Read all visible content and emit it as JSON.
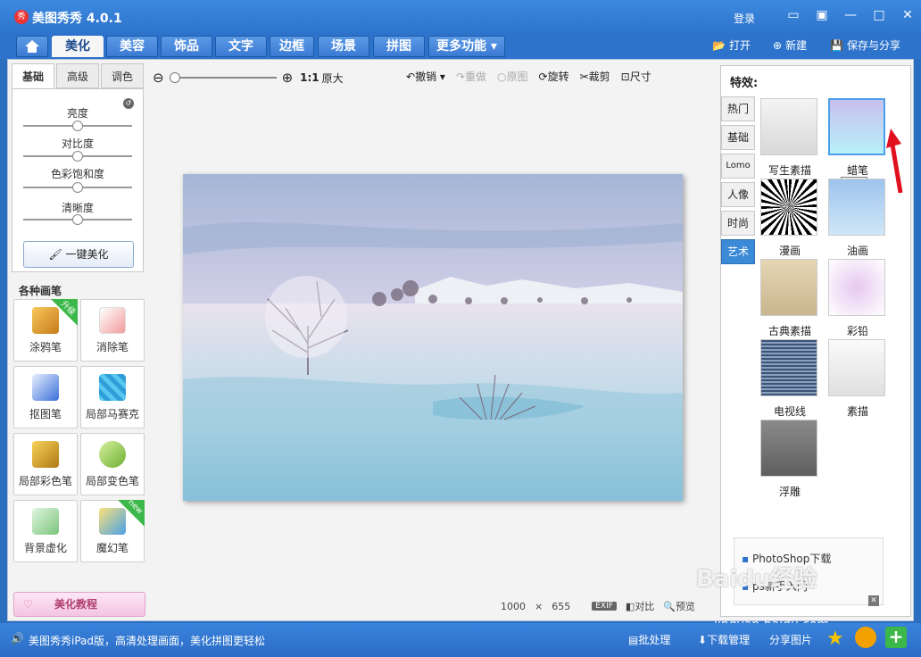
{
  "title": {
    "app_name": "美图秀秀 4.0.1",
    "login": "登录"
  },
  "tabs": [
    {
      "label": "美化"
    },
    {
      "label": "美容"
    },
    {
      "label": "饰品"
    },
    {
      "label": "文字"
    },
    {
      "label": "边框"
    },
    {
      "label": "场景"
    },
    {
      "label": "拼图"
    },
    {
      "label": "更多功能"
    }
  ],
  "file_actions": {
    "open": "打开",
    "new": "新建",
    "save_share": "保存与分享"
  },
  "left_panel": {
    "subtabs": [
      "基础",
      "高级",
      "调色"
    ],
    "sliders": [
      {
        "label": "亮度",
        "value": 0.5
      },
      {
        "label": "对比度",
        "value": 0.5
      },
      {
        "label": "色彩饱和度",
        "value": 0.5
      },
      {
        "label": "清晰度",
        "value": 0.5
      }
    ],
    "one_click": "一键美化",
    "brush_title": "各种画笔",
    "brushes": [
      {
        "label": "涂鸦笔",
        "badge": "升级"
      },
      {
        "label": "消除笔",
        "badge": ""
      },
      {
        "label": "抠图笔",
        "badge": ""
      },
      {
        "label": "局部马赛克",
        "badge": ""
      },
      {
        "label": "局部彩色笔",
        "badge": ""
      },
      {
        "label": "局部变色笔",
        "badge": ""
      },
      {
        "label": "背景虚化",
        "badge": ""
      },
      {
        "label": "魔幻笔",
        "badge": "new"
      }
    ],
    "tutorial": "美化教程"
  },
  "canvas": {
    "zoom_level": 0.02,
    "ratio": "1:1",
    "original_size": "原大",
    "tools": [
      "撤销",
      "重做",
      "原图",
      "旋转",
      "裁剪",
      "尺寸"
    ],
    "width": "1000",
    "times": "×",
    "height": "655",
    "exif": "EXIF",
    "compare": "对比",
    "preview": "预览"
  },
  "effects": {
    "title": "特效:",
    "categories": [
      "热门",
      "基础",
      "Lomo",
      "人像",
      "时尚",
      "艺术"
    ],
    "active_category": "艺术",
    "items": [
      {
        "label": "写生素描",
        "selected": false
      },
      {
        "label": "蜡笔",
        "selected": true
      },
      {
        "label": "漫画",
        "selected": false
      },
      {
        "label": "油画",
        "selected": false
      },
      {
        "label": "古典素描",
        "selected": false
      },
      {
        "label": "彩铅",
        "selected": false
      },
      {
        "label": "电视线",
        "selected": false
      },
      {
        "label": "素描",
        "selected": false
      },
      {
        "label": "浮雕",
        "selected": false
      }
    ],
    "tooltip": "蜡笔",
    "ads": [
      "PhotoShop下载",
      "ps新手入门"
    ]
  },
  "bottom": {
    "message": "美图秀秀iPad版，高清处理画面，美化拼图更轻松",
    "batch": "批处理",
    "download": "下载管理",
    "share": "分享图片"
  },
  "watermark": {
    "line1": "Baidu经验",
    "line2": "jingyan.baidu.com"
  },
  "colors": {
    "titlebar": "#3d8ae0",
    "accent": "#2d73cc",
    "selected_border": "#4aa0e8",
    "arrow": "#e0101f"
  }
}
